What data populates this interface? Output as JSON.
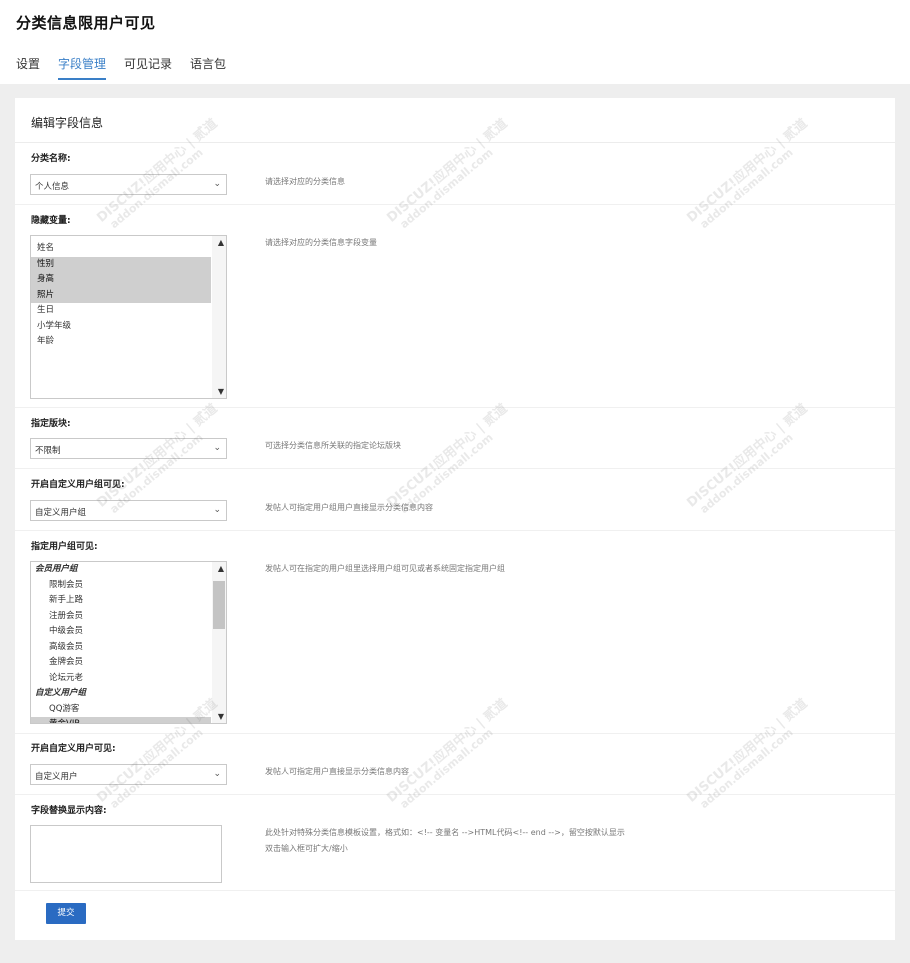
{
  "header": {
    "title": "分类信息限用户可见",
    "tabs": [
      {
        "label": "设置",
        "active": false
      },
      {
        "label": "字段管理",
        "active": true
      },
      {
        "label": "可见记录",
        "active": false
      },
      {
        "label": "语言包",
        "active": false
      }
    ]
  },
  "card": {
    "title": "编辑字段信息"
  },
  "fields": {
    "category": {
      "label": "分类名称:",
      "value": "个人信息",
      "hint": "请选择对应的分类信息"
    },
    "hidden_vars": {
      "label": "隐藏变量:",
      "hint": "请选择对应的分类信息字段变量",
      "options": [
        {
          "text": "姓名",
          "selected": false
        },
        {
          "text": "性别",
          "selected": true
        },
        {
          "text": "身高",
          "selected": true
        },
        {
          "text": "照片",
          "selected": true
        },
        {
          "text": "生日",
          "selected": false
        },
        {
          "text": "小学年级",
          "selected": false
        },
        {
          "text": "年龄",
          "selected": false
        }
      ]
    },
    "forum": {
      "label": "指定版块:",
      "value": "不限制",
      "hint": "可选择分类信息所关联的指定论坛版块"
    },
    "custom_group_enable": {
      "label": "开启自定义用户组可见:",
      "value": "自定义用户组",
      "hint": "发帖人可指定用户组用户直接显示分类信息内容"
    },
    "groups": {
      "label": "指定用户组可见:",
      "hint": "发帖人可在指定的用户组里选择用户组可见或者系统固定指定用户组",
      "options": [
        {
          "text": "会员用户组",
          "type": "group",
          "selected": false
        },
        {
          "text": "限制会员",
          "type": "child",
          "selected": false
        },
        {
          "text": "新手上路",
          "type": "child",
          "selected": false
        },
        {
          "text": "注册会员",
          "type": "child",
          "selected": false
        },
        {
          "text": "中级会员",
          "type": "child",
          "selected": false
        },
        {
          "text": "高级会员",
          "type": "child",
          "selected": false
        },
        {
          "text": "金牌会员",
          "type": "child",
          "selected": false
        },
        {
          "text": "论坛元老",
          "type": "child",
          "selected": false
        },
        {
          "text": "自定义用户组",
          "type": "group",
          "selected": false
        },
        {
          "text": "QQ游客",
          "type": "child",
          "selected": false
        },
        {
          "text": "黄金VIP",
          "type": "child",
          "selected": true
        }
      ]
    },
    "custom_user_enable": {
      "label": "开启自定义用户可见:",
      "value": "自定义用户",
      "hint": "发帖人可指定用户直接显示分类信息内容"
    },
    "replace_content": {
      "label": "字段替换显示内容:",
      "hint_line1": "此处针对特殊分类信息模板设置，格式如：<!-- 变量名 -->HTML代码<!-- end -->，留空按默认显示",
      "hint_line2": "双击输入框可扩大/缩小"
    }
  },
  "submit_label": "提交",
  "watermark_text": "DISCUZ!应用中心 | 贰道",
  "watermark_sub": "addon.dismall.com",
  "colors": {
    "accent": "#3a7fc7",
    "button": "#2a6bc2",
    "selected": "#cfcfcf"
  }
}
